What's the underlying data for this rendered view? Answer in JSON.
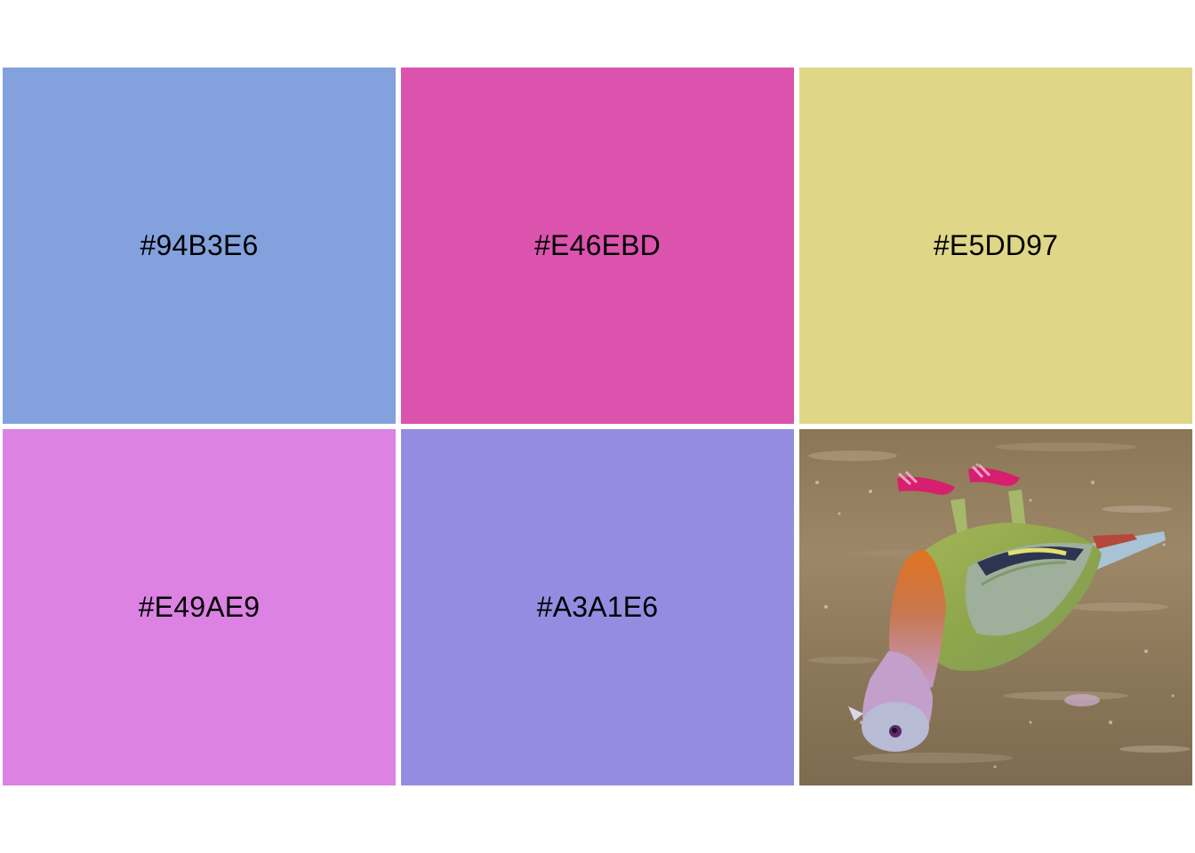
{
  "swatches": [
    {
      "label": "#94B3E6",
      "color": "#83A2DD"
    },
    {
      "label": "#E46EBD",
      "color": "#DC53AE"
    },
    {
      "label": "#E5DD97",
      "color": "#DFD687"
    },
    {
      "label": "#E49AE9",
      "color": "#DC82E2"
    },
    {
      "label": "#A3A1E6",
      "color": "#928DE0"
    }
  ],
  "photo": {
    "icon": "pigeon-photo",
    "colors": {
      "ground": "#8F7A5C",
      "ground_light": "#B7A588",
      "head": "#B7B8D2",
      "breast_orange": "#D9661F",
      "breast_pink": "#C99AC9",
      "wing_green": "#8FA64A",
      "wing_grey": "#9FB0B8",
      "feet": "#D61F6E",
      "tail": "#9FC0D8"
    }
  }
}
